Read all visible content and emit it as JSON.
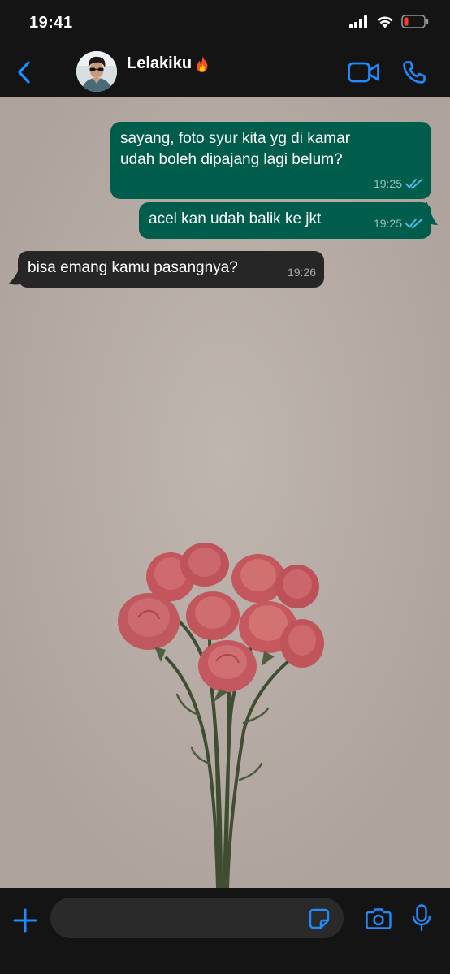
{
  "status_bar": {
    "time": "19:41",
    "icons": [
      "cellular-signal-icon",
      "wifi-icon",
      "battery-low-icon"
    ]
  },
  "header": {
    "back_icon": "chevron-left-icon",
    "contact_name": "Lelakiku",
    "contact_emoji": "🔥",
    "video_icon": "video-camera-icon",
    "call_icon": "phone-icon"
  },
  "messages": [
    {
      "direction": "outgoing",
      "text": "sayang, foto syur kita yg di kamar\nudah boleh dipajang lagi belum?",
      "time": "19:25",
      "status": "read"
    },
    {
      "direction": "outgoing",
      "text": "acel kan udah balik ke jkt",
      "time": "19:25",
      "status": "read"
    },
    {
      "direction": "incoming",
      "text": "bisa emang kamu pasangnya?",
      "time": "19:26"
    }
  ],
  "input_bar": {
    "placeholder": "",
    "plus_icon": "plus-icon",
    "sticker_icon": "sticker-icon",
    "camera_icon": "camera-icon",
    "mic_icon": "microphone-icon"
  },
  "colors": {
    "accent": "#1f8bff",
    "outgoing_bubble": "#005c4b",
    "incoming_bubble": "#262626",
    "read_ticks": "#53bdeb",
    "battery_low": "#ff3b30"
  }
}
